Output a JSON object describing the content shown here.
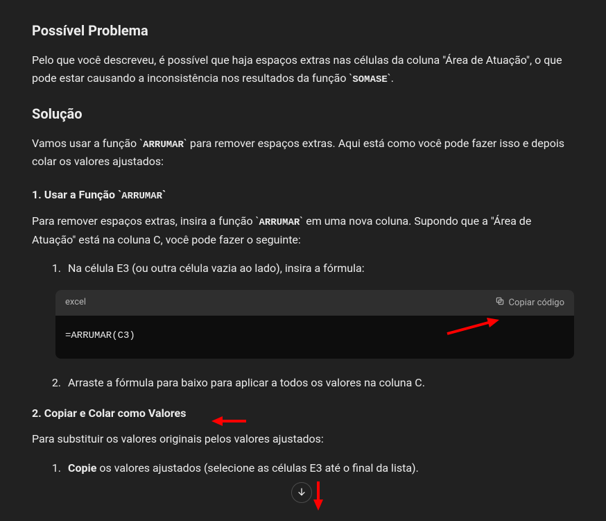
{
  "heading1": "Possível Problema",
  "para1_a": "Pelo que você descreveu, é possível que haja espaços extras nas células da coluna \"Área de Atuação\", o que pode estar causando a inconsistência nos resultados da função ",
  "para1_code": "SOMASE",
  "para1_b": ".",
  "heading2": "Solução",
  "para2_a": "Vamos usar a função ",
  "para2_code": "ARRUMAR",
  "para2_b": " para remover espaços extras. Aqui está como você pode fazer isso e depois colar os valores ajustados:",
  "step1_title_a": "1. Usar a Função ",
  "step1_title_code": "ARRUMAR",
  "step1_para_a": "Para remover espaços extras, insira a função ",
  "step1_para_code": "ARRUMAR",
  "step1_para_b": " em uma nova coluna. Supondo que a \"Área de Atuação\" está na coluna C, você pode fazer o seguinte:",
  "step1_li1": "Na célula E3 (ou outra célula vazia ao lado), insira a fórmula:",
  "code_lang": "excel",
  "copy_label": "Copiar código",
  "code_content": "=ARRUMAR(C3)",
  "step1_li2": "Arraste a fórmula para baixo para aplicar a todos os valores na coluna C.",
  "step2_title": "2. Copiar e Colar como Valores",
  "step2_para": "Para substituir os valores originais pelos valores ajustados:",
  "step2_li1_strong": "Copie",
  "step2_li1_rest": " os valores ajustados (selecione as células E3 até o final da lista)."
}
